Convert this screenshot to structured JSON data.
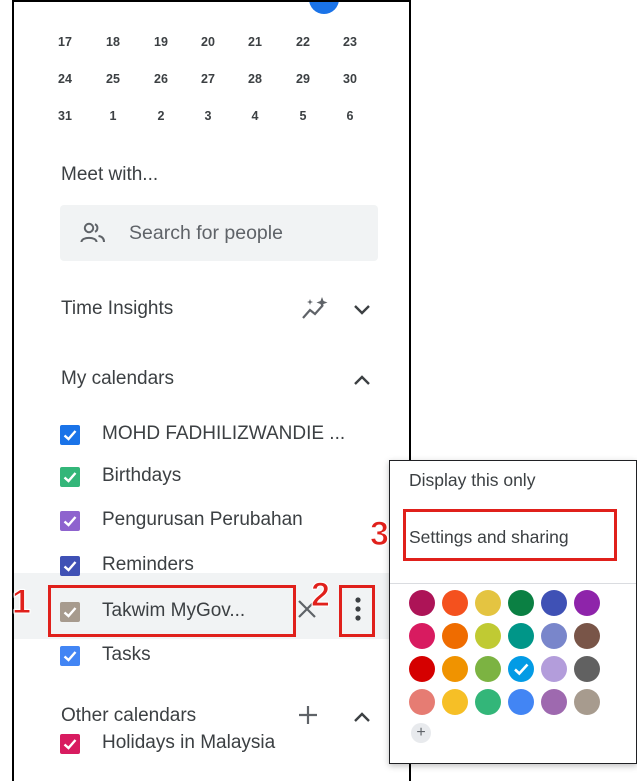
{
  "mini_calendar": {
    "weeks": [
      [
        "17",
        "18",
        "19",
        "20",
        "21",
        "22",
        "23"
      ],
      [
        "24",
        "25",
        "26",
        "27",
        "28",
        "29",
        "30"
      ],
      [
        "31",
        "1",
        "2",
        "3",
        "4",
        "5",
        "6"
      ]
    ]
  },
  "meet_with": {
    "title": "Meet with...",
    "search_placeholder": "Search for people"
  },
  "time_insights": {
    "title": "Time Insights"
  },
  "my_calendars": {
    "title": "My calendars",
    "items": [
      {
        "label": "MOHD FADHILIZWANDIE ...",
        "color": "#1a73e8"
      },
      {
        "label": "Birthdays",
        "color": "#33b679"
      },
      {
        "label": "Pengurusan Perubahan",
        "color": "#8e63ce"
      },
      {
        "label": "Reminders",
        "color": "#3f51b5"
      },
      {
        "label": "Takwim MyGov...",
        "color": "#a79b8e"
      },
      {
        "label": "Tasks",
        "color": "#4285f4"
      }
    ]
  },
  "other_calendars": {
    "title": "Other calendars",
    "items": [
      {
        "label": "Holidays in Malaysia",
        "color": "#d81b60"
      }
    ]
  },
  "context_menu": {
    "display_only": "Display this only",
    "settings_sharing": "Settings and sharing",
    "add_color": "+",
    "colors": [
      [
        "#ad1457",
        "#f4511e",
        "#e4c441",
        "#0b8043",
        "#3f51b5",
        "#8e24aa"
      ],
      [
        "#d81b60",
        "#ef6c00",
        "#c0ca33",
        "#009688",
        "#7986cb",
        "#795548"
      ],
      [
        "#d50000",
        "#f09300",
        "#7cb342",
        "#039be5",
        "#b39ddb",
        "#616161"
      ],
      [
        "#e67c73",
        "#f6bf26",
        "#33b679",
        "#4285f4",
        "#9e69af",
        "#a79b8e"
      ]
    ],
    "selected_color": "#039be5"
  },
  "annotations": {
    "step1": "1",
    "step2": "2",
    "step3": "3"
  },
  "accent_color": "#1a73e8",
  "highlight_color": "#e0201b"
}
